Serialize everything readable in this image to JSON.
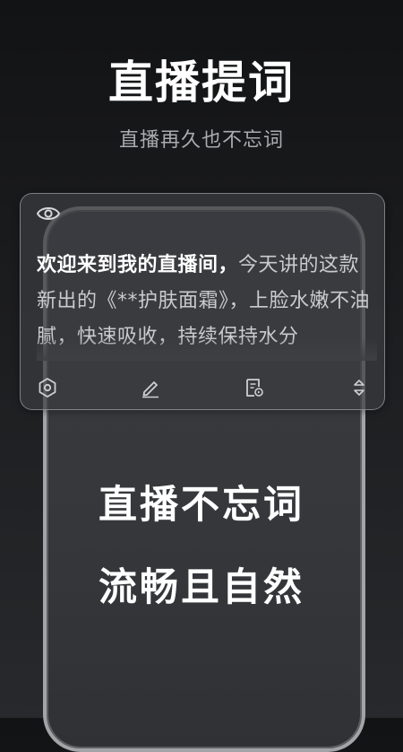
{
  "header": {
    "title": "直播提词",
    "subtitle": "直播再久也不忘词"
  },
  "prompter": {
    "highlight_text": "欢迎来到我的直播间，",
    "rest_text": "今天讲的这款新出的《**护肤面霜》，上脸水嫩不油腻，快速吸收，持续保持水分",
    "icons": [
      "eye-icon",
      "settings-icon",
      "edit-icon",
      "script-list-icon",
      "scroll-arrows-icon"
    ]
  },
  "phone": {
    "line1": "直播不忘词",
    "line2": "流畅且自然"
  },
  "colors": {
    "background": "#1c1d1f",
    "card": "#3a3c40",
    "text_primary": "#ffffff",
    "text_secondary": "#a9abaf"
  }
}
